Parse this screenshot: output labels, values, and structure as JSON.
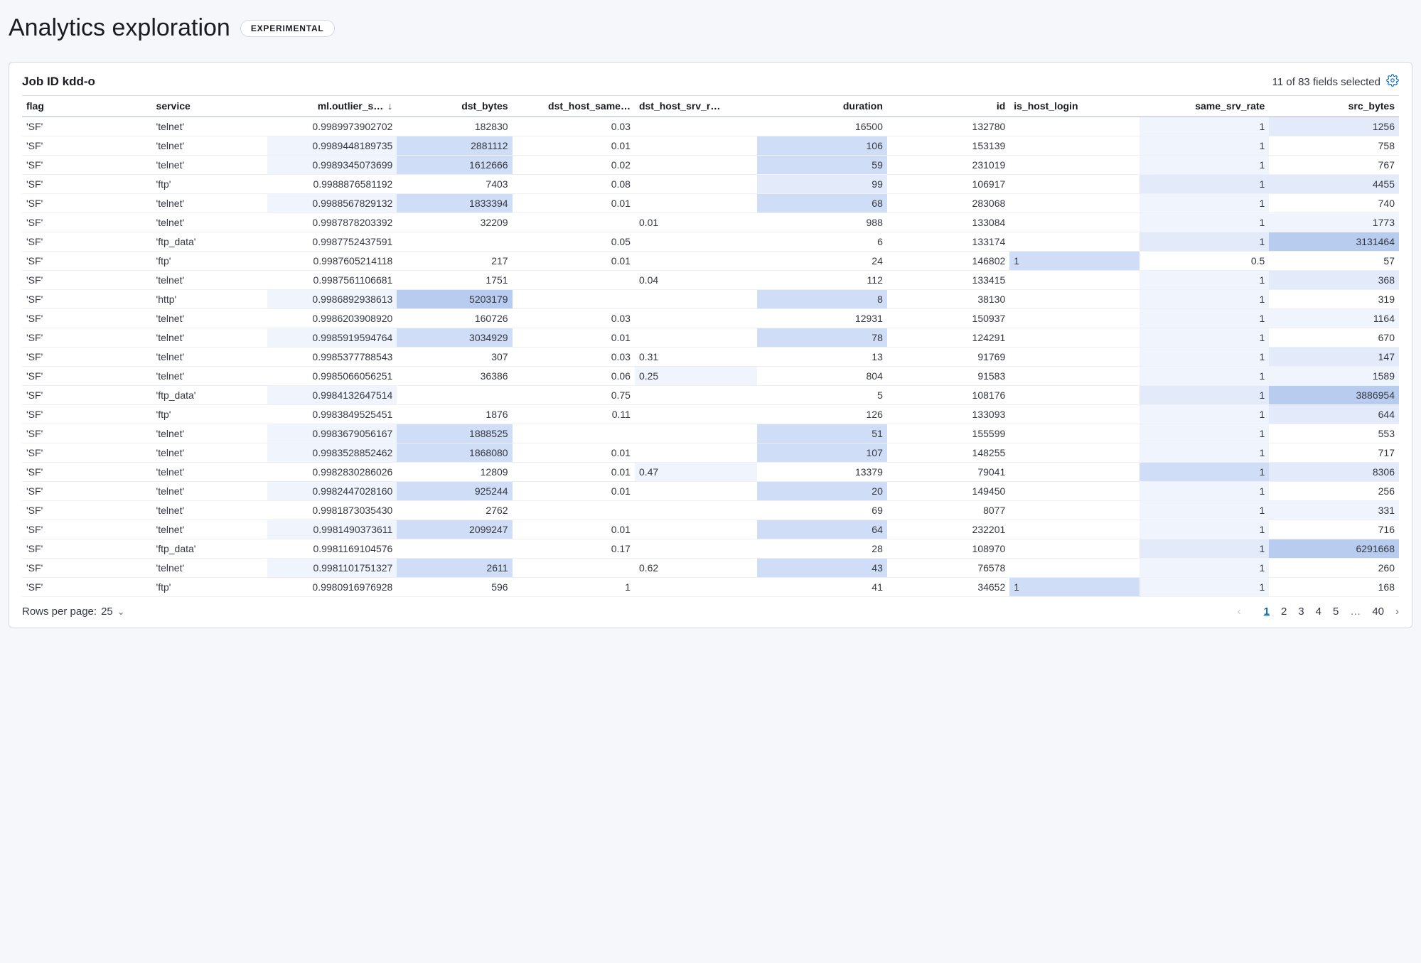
{
  "header": {
    "title": "Analytics exploration",
    "badge": "EXPERIMENTAL"
  },
  "panel": {
    "title_prefix": "Job ID ",
    "job_id": "kdd-o",
    "fields_selected_text": "11 of 83 fields selected"
  },
  "columns": [
    {
      "key": "flag",
      "label": "flag",
      "cls": "col-flag",
      "num": false
    },
    {
      "key": "service",
      "label": "service",
      "cls": "col-service",
      "num": false
    },
    {
      "key": "outlier",
      "label": "ml.outlier_s…",
      "cls": "col-outlier",
      "num": true,
      "sorted": "desc"
    },
    {
      "key": "dst_bytes",
      "label": "dst_bytes",
      "cls": "col-dstb",
      "num": true
    },
    {
      "key": "dst_same",
      "label": "dst_host_same…",
      "cls": "col-dsame",
      "num": true
    },
    {
      "key": "dst_srv",
      "label": "dst_host_srv_r…",
      "cls": "col-dsrv",
      "num": false
    },
    {
      "key": "duration",
      "label": "duration",
      "cls": "col-dur",
      "num": true
    },
    {
      "key": "id",
      "label": "id",
      "cls": "col-id",
      "num": true
    },
    {
      "key": "host_lg",
      "label": "is_host_login",
      "cls": "col-hostlg",
      "num": false
    },
    {
      "key": "ssr",
      "label": "same_srv_rate",
      "cls": "col-ssr",
      "num": true
    },
    {
      "key": "src_bytes",
      "label": "src_bytes",
      "cls": "col-srcb",
      "num": true
    }
  ],
  "rows": [
    {
      "flag": "'SF'",
      "service": "'telnet'",
      "outlier": "0.9989973902702",
      "dst_bytes": "182830",
      "dst_same": "0.03",
      "dst_srv": "",
      "duration": "16500",
      "id": "132780",
      "host_lg": "",
      "ssr": "1",
      "src_bytes": "1256",
      "hl": {
        "ssr": 1,
        "src_bytes": 2
      }
    },
    {
      "flag": "'SF'",
      "service": "'telnet'",
      "outlier": "0.9989448189735",
      "dst_bytes": "2881112",
      "dst_same": "0.01",
      "dst_srv": "",
      "duration": "106",
      "id": "153139",
      "host_lg": "",
      "ssr": "1",
      "src_bytes": "758",
      "hl": {
        "outlier": 1,
        "dst_bytes": 3,
        "duration": 3,
        "ssr": 1
      }
    },
    {
      "flag": "'SF'",
      "service": "'telnet'",
      "outlier": "0.9989345073699",
      "dst_bytes": "1612666",
      "dst_same": "0.02",
      "dst_srv": "",
      "duration": "59",
      "id": "231019",
      "host_lg": "",
      "ssr": "1",
      "src_bytes": "767",
      "hl": {
        "outlier": 1,
        "dst_bytes": 3,
        "duration": 3,
        "ssr": 1
      }
    },
    {
      "flag": "'SF'",
      "service": "'ftp'",
      "outlier": "0.9988876581192",
      "dst_bytes": "7403",
      "dst_same": "0.08",
      "dst_srv": "",
      "duration": "99",
      "id": "106917",
      "host_lg": "",
      "ssr": "1",
      "src_bytes": "4455",
      "hl": {
        "duration": 2,
        "ssr": 2,
        "src_bytes": 2
      }
    },
    {
      "flag": "'SF'",
      "service": "'telnet'",
      "outlier": "0.9988567829132",
      "dst_bytes": "1833394",
      "dst_same": "0.01",
      "dst_srv": "",
      "duration": "68",
      "id": "283068",
      "host_lg": "",
      "ssr": "1",
      "src_bytes": "740",
      "hl": {
        "outlier": 1,
        "dst_bytes": 3,
        "duration": 3,
        "ssr": 1
      }
    },
    {
      "flag": "'SF'",
      "service": "'telnet'",
      "outlier": "0.9987878203392",
      "dst_bytes": "32209",
      "dst_same": "",
      "dst_srv": "0.01",
      "duration": "988",
      "id": "133084",
      "host_lg": "",
      "ssr": "1",
      "src_bytes": "1773",
      "hl": {
        "ssr": 1,
        "src_bytes": 1
      }
    },
    {
      "flag": "'SF'",
      "service": "'ftp_data'",
      "outlier": "0.9987752437591",
      "dst_bytes": "",
      "dst_same": "0.05",
      "dst_srv": "",
      "duration": "6",
      "id": "133174",
      "host_lg": "",
      "ssr": "1",
      "src_bytes": "3131464",
      "hl": {
        "ssr": 2,
        "src_bytes": 4
      }
    },
    {
      "flag": "'SF'",
      "service": "'ftp'",
      "outlier": "0.9987605214118",
      "dst_bytes": "217",
      "dst_same": "0.01",
      "dst_srv": "",
      "duration": "24",
      "id": "146802",
      "host_lg": "1",
      "ssr": "0.5",
      "src_bytes": "57",
      "hl": {
        "host_lg": 3
      }
    },
    {
      "flag": "'SF'",
      "service": "'telnet'",
      "outlier": "0.9987561106681",
      "dst_bytes": "1751",
      "dst_same": "",
      "dst_srv": "0.04",
      "duration": "112",
      "id": "133415",
      "host_lg": "",
      "ssr": "1",
      "src_bytes": "368",
      "hl": {
        "ssr": 1,
        "src_bytes": 2
      }
    },
    {
      "flag": "'SF'",
      "service": "'http'",
      "outlier": "0.9986892938613",
      "dst_bytes": "5203179",
      "dst_same": "",
      "dst_srv": "",
      "duration": "8",
      "id": "38130",
      "host_lg": "",
      "ssr": "1",
      "src_bytes": "319",
      "hl": {
        "outlier": 1,
        "dst_bytes": 4,
        "duration": 3,
        "ssr": 1
      }
    },
    {
      "flag": "'SF'",
      "service": "'telnet'",
      "outlier": "0.9986203908920",
      "dst_bytes": "160726",
      "dst_same": "0.03",
      "dst_srv": "",
      "duration": "12931",
      "id": "150937",
      "host_lg": "",
      "ssr": "1",
      "src_bytes": "1164",
      "hl": {
        "ssr": 1,
        "src_bytes": 1
      }
    },
    {
      "flag": "'SF'",
      "service": "'telnet'",
      "outlier": "0.9985919594764",
      "dst_bytes": "3034929",
      "dst_same": "0.01",
      "dst_srv": "",
      "duration": "78",
      "id": "124291",
      "host_lg": "",
      "ssr": "1",
      "src_bytes": "670",
      "hl": {
        "outlier": 1,
        "dst_bytes": 3,
        "duration": 3,
        "ssr": 1
      }
    },
    {
      "flag": "'SF'",
      "service": "'telnet'",
      "outlier": "0.9985377788543",
      "dst_bytes": "307",
      "dst_same": "0.03",
      "dst_srv": "0.31",
      "duration": "13",
      "id": "91769",
      "host_lg": "",
      "ssr": "1",
      "src_bytes": "147",
      "hl": {
        "ssr": 1,
        "src_bytes": 2
      }
    },
    {
      "flag": "'SF'",
      "service": "'telnet'",
      "outlier": "0.9985066056251",
      "dst_bytes": "36386",
      "dst_same": "0.06",
      "dst_srv": "0.25",
      "duration": "804",
      "id": "91583",
      "host_lg": "",
      "ssr": "1",
      "src_bytes": "1589",
      "hl": {
        "dst_srv": 1,
        "ssr": 1,
        "src_bytes": 1
      }
    },
    {
      "flag": "'SF'",
      "service": "'ftp_data'",
      "outlier": "0.9984132647514",
      "dst_bytes": "",
      "dst_same": "0.75",
      "dst_srv": "",
      "duration": "5",
      "id": "108176",
      "host_lg": "",
      "ssr": "1",
      "src_bytes": "3886954",
      "hl": {
        "outlier": 1,
        "ssr": 2,
        "src_bytes": 4
      }
    },
    {
      "flag": "'SF'",
      "service": "'ftp'",
      "outlier": "0.9983849525451",
      "dst_bytes": "1876",
      "dst_same": "0.11",
      "dst_srv": "",
      "duration": "126",
      "id": "133093",
      "host_lg": "",
      "ssr": "1",
      "src_bytes": "644",
      "hl": {
        "ssr": 1,
        "src_bytes": 2
      }
    },
    {
      "flag": "'SF'",
      "service": "'telnet'",
      "outlier": "0.9983679056167",
      "dst_bytes": "1888525",
      "dst_same": "",
      "dst_srv": "",
      "duration": "51",
      "id": "155599",
      "host_lg": "",
      "ssr": "1",
      "src_bytes": "553",
      "hl": {
        "outlier": 1,
        "dst_bytes": 3,
        "duration": 3,
        "ssr": 1
      }
    },
    {
      "flag": "'SF'",
      "service": "'telnet'",
      "outlier": "0.9983528852462",
      "dst_bytes": "1868080",
      "dst_same": "0.01",
      "dst_srv": "",
      "duration": "107",
      "id": "148255",
      "host_lg": "",
      "ssr": "1",
      "src_bytes": "717",
      "hl": {
        "outlier": 1,
        "dst_bytes": 3,
        "duration": 3,
        "ssr": 1
      }
    },
    {
      "flag": "'SF'",
      "service": "'telnet'",
      "outlier": "0.9982830286026",
      "dst_bytes": "12809",
      "dst_same": "0.01",
      "dst_srv": "0.47",
      "duration": "13379",
      "id": "79041",
      "host_lg": "",
      "ssr": "1",
      "src_bytes": "8306",
      "hl": {
        "dst_srv": 1,
        "ssr": 3,
        "src_bytes": 2
      }
    },
    {
      "flag": "'SF'",
      "service": "'telnet'",
      "outlier": "0.9982447028160",
      "dst_bytes": "925244",
      "dst_same": "0.01",
      "dst_srv": "",
      "duration": "20",
      "id": "149450",
      "host_lg": "",
      "ssr": "1",
      "src_bytes": "256",
      "hl": {
        "outlier": 1,
        "dst_bytes": 3,
        "duration": 3,
        "ssr": 1
      }
    },
    {
      "flag": "'SF'",
      "service": "'telnet'",
      "outlier": "0.9981873035430",
      "dst_bytes": "2762",
      "dst_same": "",
      "dst_srv": "",
      "duration": "69",
      "id": "8077",
      "host_lg": "",
      "ssr": "1",
      "src_bytes": "331",
      "hl": {
        "ssr": 1,
        "src_bytes": 1
      }
    },
    {
      "flag": "'SF'",
      "service": "'telnet'",
      "outlier": "0.9981490373611",
      "dst_bytes": "2099247",
      "dst_same": "0.01",
      "dst_srv": "",
      "duration": "64",
      "id": "232201",
      "host_lg": "",
      "ssr": "1",
      "src_bytes": "716",
      "hl": {
        "outlier": 1,
        "dst_bytes": 3,
        "duration": 3,
        "ssr": 1
      }
    },
    {
      "flag": "'SF'",
      "service": "'ftp_data'",
      "outlier": "0.9981169104576",
      "dst_bytes": "",
      "dst_same": "0.17",
      "dst_srv": "",
      "duration": "28",
      "id": "108970",
      "host_lg": "",
      "ssr": "1",
      "src_bytes": "6291668",
      "hl": {
        "ssr": 2,
        "src_bytes": 4
      }
    },
    {
      "flag": "'SF'",
      "service": "'telnet'",
      "outlier": "0.9981101751327",
      "dst_bytes": "2611",
      "dst_same": "",
      "dst_srv": "0.62",
      "duration": "43",
      "id": "76578",
      "host_lg": "",
      "ssr": "1",
      "src_bytes": "260",
      "hl": {
        "outlier": 1,
        "dst_bytes": 3,
        "duration": 3,
        "ssr": 1
      }
    },
    {
      "flag": "'SF'",
      "service": "'ftp'",
      "outlier": "0.9980916976928",
      "dst_bytes": "596",
      "dst_same": "1",
      "dst_srv": "",
      "duration": "41",
      "id": "34652",
      "host_lg": "1",
      "ssr": "1",
      "src_bytes": "168",
      "hl": {
        "host_lg": 3,
        "ssr": 1
      }
    }
  ],
  "footer": {
    "rpp_label": "Rows per page: ",
    "rpp_value": "25",
    "pages": [
      "1",
      "2",
      "3",
      "4",
      "5"
    ],
    "ellipsis": "…",
    "last_page": "40",
    "current_page": "1"
  }
}
